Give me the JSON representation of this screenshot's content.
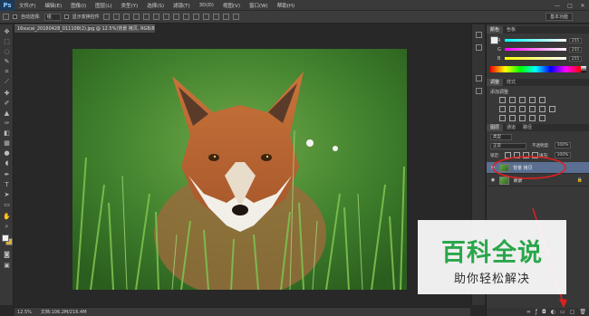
{
  "app": {
    "logo": "Ps",
    "menu": [
      "文件(F)",
      "编辑(E)",
      "图像(I)",
      "图层(L)",
      "类型(Y)",
      "选择(S)",
      "滤镜(T)",
      "3D(D)",
      "视图(V)",
      "窗口(W)",
      "帮助(H)"
    ],
    "window_controls": [
      "—",
      "□",
      "✕"
    ]
  },
  "options_bar": {
    "auto_select_label": "自动选择:",
    "auto_select_value": "组",
    "show_transform_label": "显示变换控件",
    "workspace": "基本功能"
  },
  "document": {
    "tab_title": "16sucai_20160428_011108(2).jpg @ 12.5%(背景 拷贝, RGB/8#) *",
    "zoom": "12.5%",
    "doc_info": "文档:106.2M/216.4M"
  },
  "color_panel": {
    "tabs": [
      "颜色",
      "色板"
    ],
    "channels": [
      {
        "label": "R",
        "value": "255"
      },
      {
        "label": "G",
        "value": "255"
      },
      {
        "label": "B",
        "value": "255"
      }
    ]
  },
  "adjustments_panel": {
    "tabs": [
      "调整",
      "样式"
    ],
    "heading": "添加调整"
  },
  "layers_panel": {
    "tabs": [
      "图层",
      "通道",
      "路径"
    ],
    "kind_filter": "类型",
    "blend_mode": "正常",
    "opacity_label": "不透明度:",
    "opacity_value": "100%",
    "lock_label": "锁定:",
    "fill_label": "填充:",
    "fill_value": "100%",
    "layers": [
      {
        "name": "背景 拷贝",
        "selected": true
      },
      {
        "name": "背景",
        "selected": false
      }
    ]
  },
  "watermark": {
    "title": "百科全说",
    "subtitle": "助你轻松解决"
  },
  "colors": {
    "selected_layer": "#5a6f92",
    "watermark_green": "#2aa64a",
    "annotation_red": "#e02020"
  }
}
